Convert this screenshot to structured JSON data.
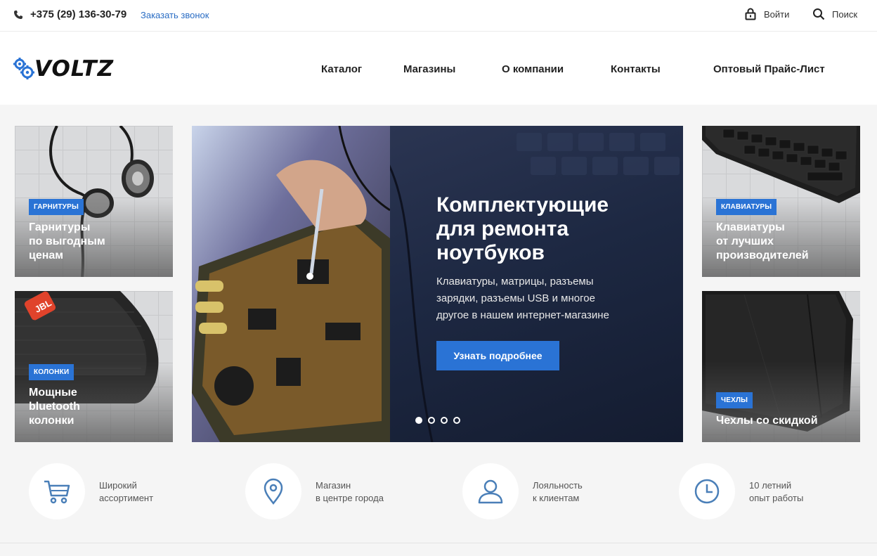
{
  "topbar": {
    "phone": "+375 (29) 136-30-79",
    "callback": "Заказать звонок",
    "login": "Войти",
    "search": "Поиск"
  },
  "header": {
    "logo_text": "VOLTZ",
    "nav": [
      "Каталог",
      "Магазины",
      "О компании",
      "Контакты",
      "Оптовый Прайс-Лист"
    ]
  },
  "tiles": {
    "headsets": {
      "tag": "ГАРНИТУРЫ",
      "line1": "Гарнитуры",
      "line2": "по выгодным",
      "line3": "ценам"
    },
    "speakers": {
      "tag": "КОЛОНКИ",
      "brand": "JBL",
      "line1": "Мощные",
      "line2": "bluetooth",
      "line3": "колонки"
    },
    "keyboards": {
      "tag": "КЛАВИАТУРЫ",
      "line1": "Клавиатуры",
      "line2": "от лучших",
      "line3": "производителей"
    },
    "covers": {
      "tag": "ЧЕХЛЫ",
      "line1": "Чехлы со скидкой"
    }
  },
  "hero": {
    "title1": "Комплектующие",
    "title2": "для ремонта",
    "title3": "ноутбуков",
    "text1": "Клавиатуры, матрицы, разъемы",
    "text2": "зарядки, разъемы USB и многое",
    "text3": "другое в нашем интернет-магазине",
    "button": "Узнать подробнее",
    "slides": 4,
    "active_slide": 1
  },
  "features": [
    {
      "icon": "cart-icon",
      "line1": "Широкий",
      "line2": "ассортимент"
    },
    {
      "icon": "map-pin-icon",
      "line1": "Магазин",
      "line2": "в центре города"
    },
    {
      "icon": "user-icon",
      "line1": "Лояльность",
      "line2": "к клиентам"
    },
    {
      "icon": "clock-icon",
      "line1": "10 летний",
      "line2": "опыт работы"
    }
  ],
  "colors": {
    "accent": "#2a73d5",
    "link": "#2a6dc4",
    "icon": "#4a7fb8"
  }
}
